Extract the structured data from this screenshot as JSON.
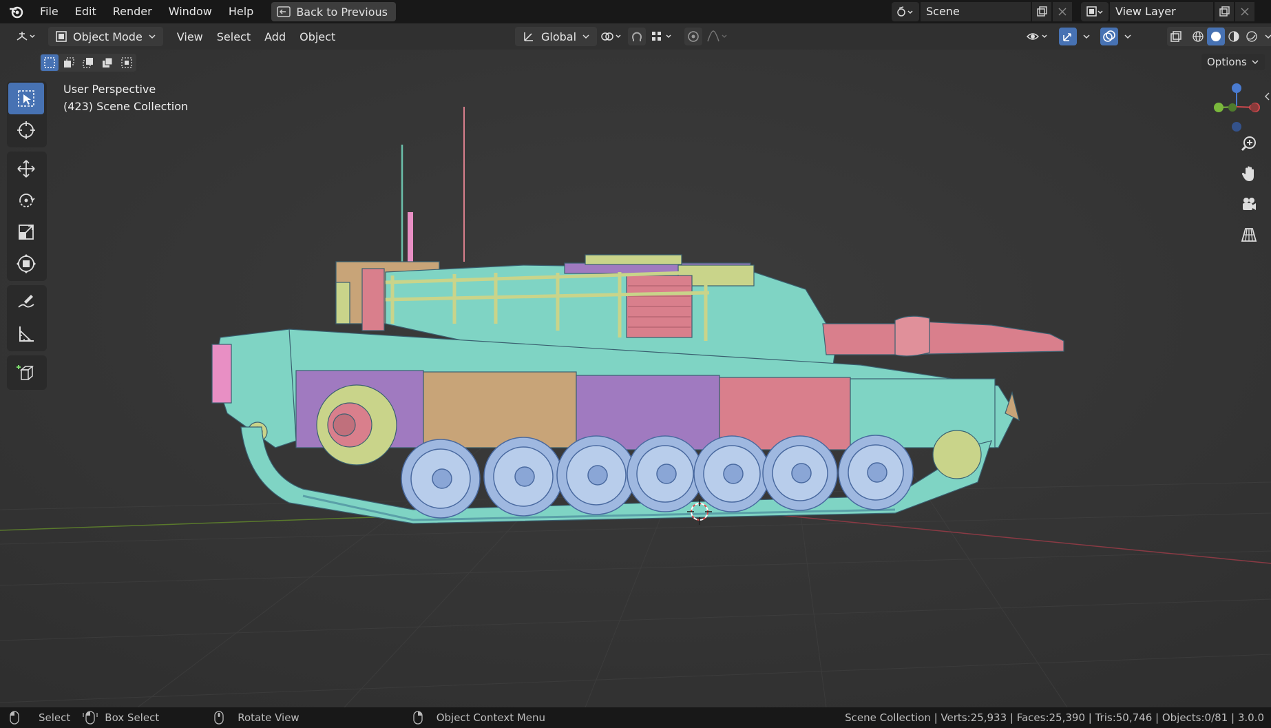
{
  "topbar": {
    "menus": [
      "File",
      "Edit",
      "Render",
      "Window",
      "Help"
    ],
    "back_label": "Back to Previous",
    "scene_name": "Scene",
    "view_layer": "View Layer"
  },
  "header": {
    "mode": "Object Mode",
    "menus": [
      "View",
      "Select",
      "Add",
      "Object"
    ],
    "orientation": "Global",
    "options": "Options"
  },
  "viewport": {
    "perspective": "User Perspective",
    "collection": "(423) Scene Collection"
  },
  "statusbar": {
    "select": "Select",
    "box_select": "Box Select",
    "rotate_view": "Rotate View",
    "context_menu": "Object Context Menu",
    "stats": "Scene Collection | Verts:25,933 | Faces:25,390 | Tris:50,746 | Objects:0/81 | 3.0.0"
  },
  "colors": {
    "hull": "#7fd4c4",
    "purple": "#a07ac0",
    "tan": "#c8a478",
    "pink": "#d97f8c",
    "yellow_green": "#c9d48a",
    "wheel": "#9fb8e0",
    "accent": "#4772b3"
  }
}
